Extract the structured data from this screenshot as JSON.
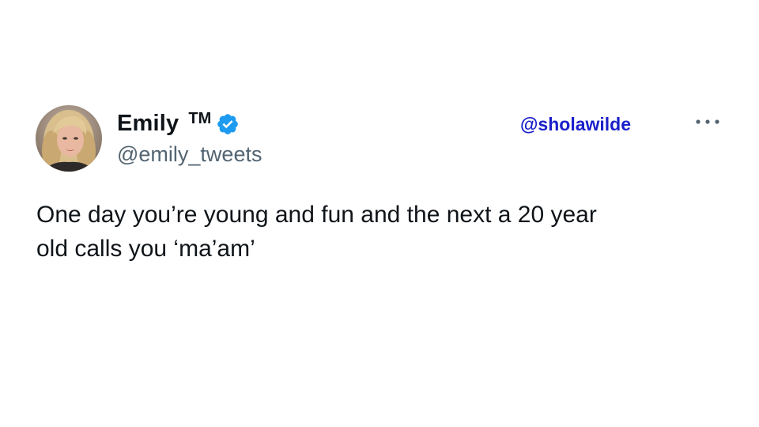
{
  "tweet": {
    "author": {
      "display_name": "Emily",
      "tm_mark": "TM",
      "handle": "@emily_tweets",
      "verified": true,
      "avatar_icon": "profile-photo"
    },
    "watermark": "@sholawilde",
    "text_line1": "One day you’re young and fun and the next a 20 year",
    "text_line2": "old calls you ‘ma’am’",
    "more_icon": "ellipsis-icon"
  },
  "colors": {
    "background": "#ffffff",
    "text": "#0f1419",
    "secondary_text": "#536471",
    "verified_badge": "#1d9bf0",
    "watermark": "#1a20c9"
  }
}
